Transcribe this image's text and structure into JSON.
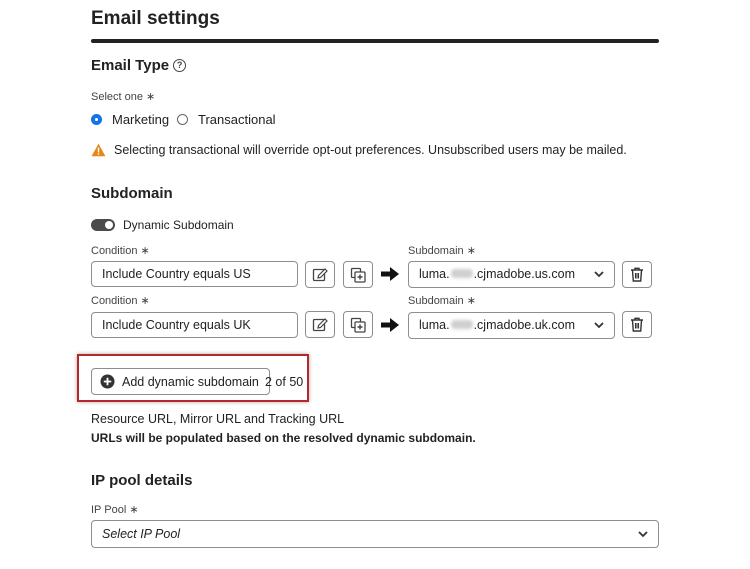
{
  "page": {
    "title": "Email settings"
  },
  "email_type": {
    "heading": "Email Type",
    "help_icon": "help-circle-icon",
    "select_label": "Select one ∗",
    "options": [
      {
        "label": "Marketing",
        "selected": true
      },
      {
        "label": "Transactional",
        "selected": false
      }
    ],
    "warning": "Selecting transactional will override opt-out preferences. Unsubscribed users may be mailed."
  },
  "subdomain": {
    "heading": "Subdomain",
    "toggle_label": "Dynamic Subdomain",
    "toggle_on": true,
    "rows": [
      {
        "condition_label": "Condition ∗",
        "condition_value": "Include Country equals US",
        "subdomain_label": "Subdomain ∗",
        "subdomain_prefix": "luma.",
        "subdomain_suffix": ".cjmadobe.us.com"
      },
      {
        "condition_label": "Condition ∗",
        "condition_value": "Include Country equals UK",
        "subdomain_label": "Subdomain ∗",
        "subdomain_prefix": "luma.",
        "subdomain_suffix": ".cjmadobe.uk.com"
      }
    ],
    "add_button_label": "Add dynamic subdomain",
    "count": "2 of 50",
    "urls_title": "Resource URL, Mirror URL and Tracking URL",
    "urls_note": "URLs will be populated based on the resolved dynamic subdomain."
  },
  "ip_pool": {
    "heading": "IP pool details",
    "label": "IP Pool ∗",
    "placeholder": "Select IP Pool"
  },
  "colors": {
    "accent": "#1473e6",
    "warning": "#e68619",
    "highlight": "#b5272a"
  }
}
